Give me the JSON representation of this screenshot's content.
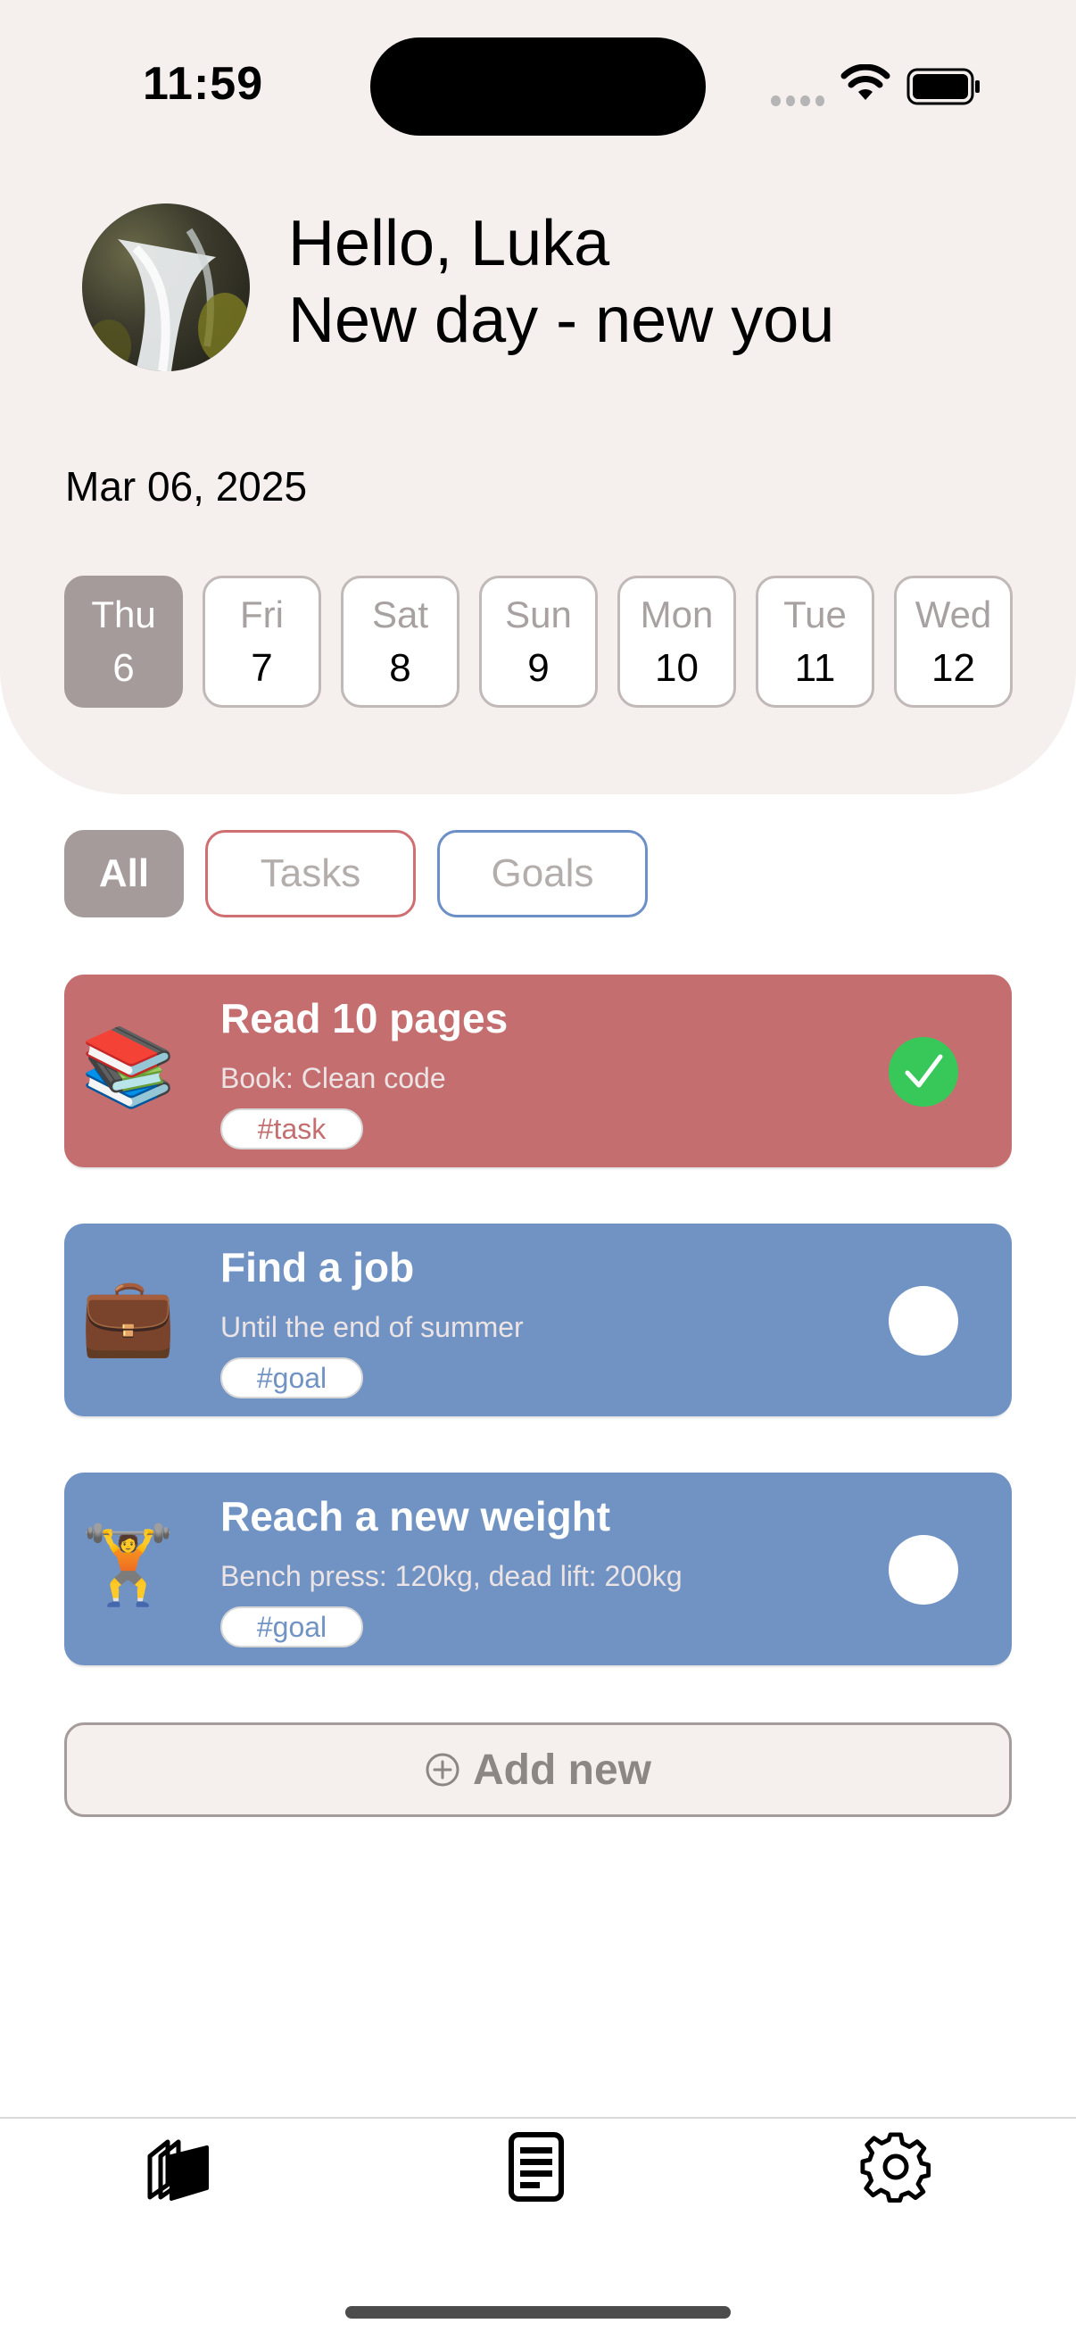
{
  "status_bar": {
    "time": "11:59"
  },
  "greeting": {
    "line1": "Hello, Luka",
    "line2": "New day - new you"
  },
  "date": "Mar 06, 2025",
  "days": [
    {
      "name": "Thu",
      "num": "6",
      "selected": true
    },
    {
      "name": "Fri",
      "num": "7"
    },
    {
      "name": "Sat",
      "num": "8"
    },
    {
      "name": "Sun",
      "num": "9"
    },
    {
      "name": "Mon",
      "num": "10"
    },
    {
      "name": "Tue",
      "num": "11"
    },
    {
      "name": "Wed",
      "num": "12"
    }
  ],
  "filters": {
    "all": "All",
    "tasks": "Tasks",
    "goals": "Goals"
  },
  "items": [
    {
      "emoji": "📚",
      "title": "Read 10 pages",
      "subtitle": "Book: Clean code",
      "tag": "#task",
      "done": true
    },
    {
      "emoji": "💼",
      "title": "Find a job",
      "subtitle": "Until the end of summer",
      "tag": "#goal",
      "done": false
    },
    {
      "emoji": "🏋️",
      "title": "Reach a new weight",
      "subtitle": "Bench press: 120kg, dead lift: 200kg",
      "tag": "#goal",
      "done": false
    }
  ],
  "add_new": {
    "label": "Add new"
  },
  "colors": {
    "task": "#c46e70",
    "goal": "#7093c4",
    "selected": "#a49b9a",
    "done": "#38c759"
  },
  "tabs": {
    "left": "stack-icon",
    "middle": "document-icon",
    "right": "gear-icon"
  }
}
